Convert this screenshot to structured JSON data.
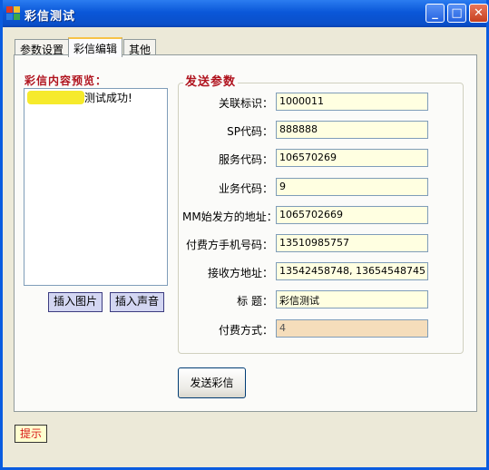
{
  "window": {
    "title": "彩信测试",
    "controls": {
      "minimize": "_",
      "maximize": "□",
      "close": "✕"
    }
  },
  "tabs": [
    {
      "label": "参数设置",
      "active": false
    },
    {
      "label": "彩信编辑",
      "active": true
    },
    {
      "label": "其他",
      "active": false
    }
  ],
  "preview": {
    "label": "彩信内容预览：",
    "text": "测试成功!"
  },
  "buttons": {
    "insert_image": "插入图片",
    "insert_sound": "插入声音",
    "send": "发送彩信"
  },
  "send_params": {
    "title": "发送参数",
    "fields": [
      {
        "label": "关联标识：",
        "value": "1000011"
      },
      {
        "label": "SP代码：",
        "value": "888888"
      },
      {
        "label": "服务代码：",
        "value": "106570269"
      },
      {
        "label": "业务代码：",
        "value": "9"
      },
      {
        "label": "MM始发方的地址：",
        "value": "1065702669"
      },
      {
        "label": "付费方手机号码：",
        "value": "13510985757"
      },
      {
        "label": "接收方地址：",
        "value": "13542458748, 13654548745"
      },
      {
        "label": "标  题：",
        "value": "彩信测试"
      },
      {
        "label": "付费方式：",
        "value": "4",
        "disabled": true
      }
    ]
  },
  "hint": "提示",
  "colors": {
    "accent_red": "#b0131e",
    "input_bg": "#ffffe1",
    "disabled_input_bg": "#f5ddbb",
    "title_bar": "#0a57d8"
  }
}
